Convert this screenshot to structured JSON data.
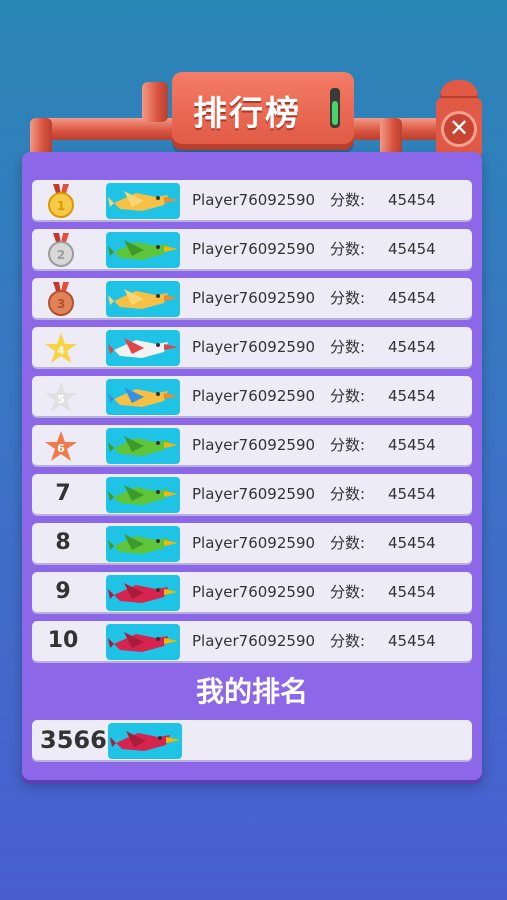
{
  "header": {
    "title": "排行榜",
    "close_label": "✕"
  },
  "leaderboard": [
    {
      "rank": "1",
      "medal": "gold-medal",
      "bird": "yellow-bird",
      "player": "Player76092590",
      "score_label": "分数:",
      "score": "45454"
    },
    {
      "rank": "2",
      "medal": "silver-medal",
      "bird": "green-toucan",
      "player": "Player76092590",
      "score_label": "分数:",
      "score": "45454"
    },
    {
      "rank": "3",
      "medal": "bronze-medal",
      "bird": "yellow-bird",
      "player": "Player76092590",
      "score_label": "分数:",
      "score": "45454"
    },
    {
      "rank": "4",
      "medal": "yellow-star",
      "bird": "red-heron",
      "player": "Player76092590",
      "score_label": "分数:",
      "score": "45454"
    },
    {
      "rank": "5",
      "medal": "silver-star",
      "bird": "blue-bird",
      "player": "Player76092590",
      "score_label": "分数:",
      "score": "45454"
    },
    {
      "rank": "6",
      "medal": "orange-star",
      "bird": "green-toucan",
      "player": "Player76092590",
      "score_label": "分数:",
      "score": "45454"
    },
    {
      "rank": "7",
      "bird": "green-toucan",
      "player": "Player76092590",
      "score_label": "分数:",
      "score": "45454"
    },
    {
      "rank": "8",
      "bird": "green-toucan",
      "player": "Player76092590",
      "score_label": "分数:",
      "score": "45454"
    },
    {
      "rank": "9",
      "bird": "red-cardinal",
      "player": "Player76092590",
      "score_label": "分数:",
      "score": "45454"
    },
    {
      "rank": "10",
      "bird": "red-cardinal",
      "player": "Player76092590",
      "score_label": "分数:",
      "score": "45454"
    }
  ],
  "my_rank": {
    "title": "我的排名",
    "rank": "3566",
    "bird": "red-cardinal"
  },
  "colors": {
    "panel": "#8c67e8",
    "row": "#ecebf6",
    "bird_card": "#1fc3e6",
    "pipe": "#e05842"
  }
}
